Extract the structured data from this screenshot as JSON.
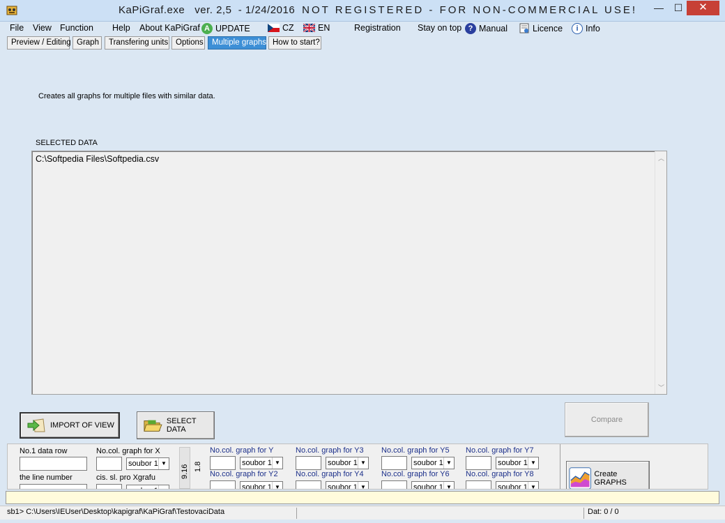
{
  "window": {
    "app_name": "KaPiGraf.exe",
    "version": "ver. 2,5  - 1/24/2016",
    "notice": "NOT REGISTERED - FOR NON-COMMERCIAL USE!",
    "minimize": "—",
    "maximize": "☐",
    "close": "✕"
  },
  "menu": {
    "file": "File",
    "view": "View",
    "function": "Function",
    "help": "Help",
    "about": "About KaPiGraf",
    "update": "UPDATE",
    "cz": "CZ",
    "en": "EN",
    "registration": "Registration",
    "stay_on_top": "Stay on top",
    "manual": "Manual",
    "licence": "Licence",
    "info": "Info"
  },
  "tabs": [
    {
      "label": "Preview / Editing"
    },
    {
      "label": "Graph"
    },
    {
      "label": "Transfering units"
    },
    {
      "label": "Options"
    },
    {
      "label": "Multiple graphs"
    },
    {
      "label": "How to start?"
    }
  ],
  "main": {
    "description": "Creates all graphs for multiple files with similar data.",
    "selected_label": "SELECTED DATA",
    "selected_files": [
      "C:\\Softpedia Files\\Softpedia.csv"
    ]
  },
  "buttons": {
    "import": "IMPORT OF VIEW",
    "select": "SELECT DATA",
    "compare": "Compare",
    "create": "Create GRAPHS"
  },
  "panel": {
    "first_row_label": "No.1 data row",
    "line_number_label": "the line number",
    "x_label": "No.col. graph for X",
    "x_cz_label": "cis. sl. pro Xgrafu",
    "vert_a": "9.16",
    "vert_b": "1.8",
    "dropdown_value": "soubor 1",
    "y_labels": {
      "y1": "No.col. graph for Y",
      "y2": "No.col. graph for Y2",
      "y3": "No.col. graph for Y3",
      "y4": "No.col. graph for Y4",
      "y5": "No.col. graph for Y5",
      "y6": "No.col. graph for Y6",
      "y7": "No.col. graph for Y7",
      "y8": "No.col. graph for Y8"
    }
  },
  "status": {
    "path": "sb1> C:\\Users\\IEUser\\Desktop\\kapigraf\\KaPiGraf\\TestovaciData",
    "dat": "Dat: 0 / 0"
  }
}
